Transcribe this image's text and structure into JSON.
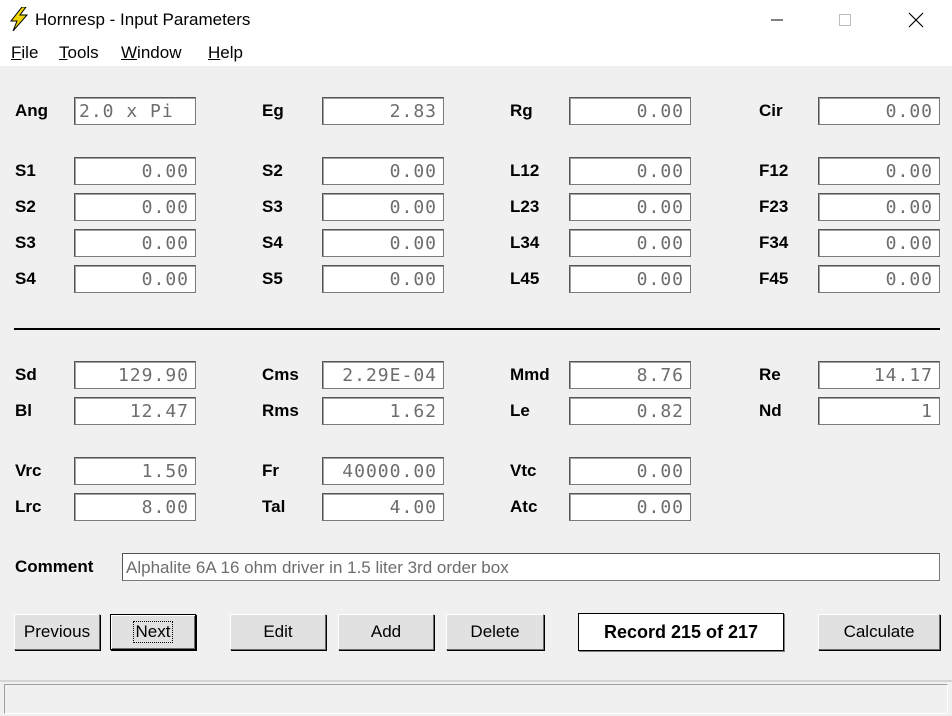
{
  "window": {
    "title": "Hornresp - Input Parameters",
    "icon": "lightning-bolt-icon",
    "controls": [
      "minimize",
      "maximize",
      "close"
    ]
  },
  "menu": [
    {
      "label": "File",
      "mnemonic": "F",
      "rest": "ile"
    },
    {
      "label": "Tools",
      "mnemonic": "T",
      "rest": "ools"
    },
    {
      "label": "Window",
      "mnemonic": "W",
      "rest": "indow"
    },
    {
      "label": "Help",
      "mnemonic": "H",
      "rest": "elp"
    }
  ],
  "params": {
    "Ang": "2.0 x Pi",
    "Eg": "2.83",
    "Rg": "0.00",
    "Cir": "0.00",
    "S1": "0.00",
    "S2": "0.00",
    "L12": "0.00",
    "F12": "0.00",
    "S2b": "0.00",
    "S3": "0.00",
    "L23": "0.00",
    "F23": "0.00",
    "S3b": "0.00",
    "S4": "0.00",
    "L34": "0.00",
    "F34": "0.00",
    "S4b": "0.00",
    "S5": "0.00",
    "L45": "0.00",
    "F45": "0.00",
    "Sd": "129.90",
    "Cms": "2.29E-04",
    "Mmd": "8.76",
    "Re": "14.17",
    "Bl": "12.47",
    "Rms": "1.62",
    "Le": "0.82",
    "Nd": "1",
    "Vrc": "1.50",
    "Fr": "40000.00",
    "Vtc": "0.00",
    "Lrc": "8.00",
    "Tal": "4.00",
    "Atc": "0.00"
  },
  "labels": {
    "Ang": "Ang",
    "Eg": "Eg",
    "Rg": "Rg",
    "Cir": "Cir",
    "S1": "S1",
    "S2": "S2",
    "L12": "L12",
    "F12": "F12",
    "S2b": "S2",
    "S3": "S3",
    "L23": "L23",
    "F23": "F23",
    "S3b": "S3",
    "S4": "S4",
    "L34": "L34",
    "F34": "F34",
    "S4b": "S4",
    "S5": "S5",
    "L45": "L45",
    "F45": "F45",
    "Sd": "Sd",
    "Cms": "Cms",
    "Mmd": "Mmd",
    "Re": "Re",
    "Bl": "Bl",
    "Rms": "Rms",
    "Le": "Le",
    "Nd": "Nd",
    "Vrc": "Vrc",
    "Fr": "Fr",
    "Vtc": "Vtc",
    "Lrc": "Lrc",
    "Tal": "Tal",
    "Atc": "Atc"
  },
  "comment": {
    "label": "Comment",
    "value": "Alphalite 6A 16 ohm driver in 1.5 liter 3rd order box"
  },
  "buttons": {
    "previous": "Previous",
    "next": "Next",
    "edit": "Edit",
    "add": "Add",
    "delete": "Delete",
    "calculate": "Calculate"
  },
  "record": "Record 215 of 217",
  "status": ""
}
